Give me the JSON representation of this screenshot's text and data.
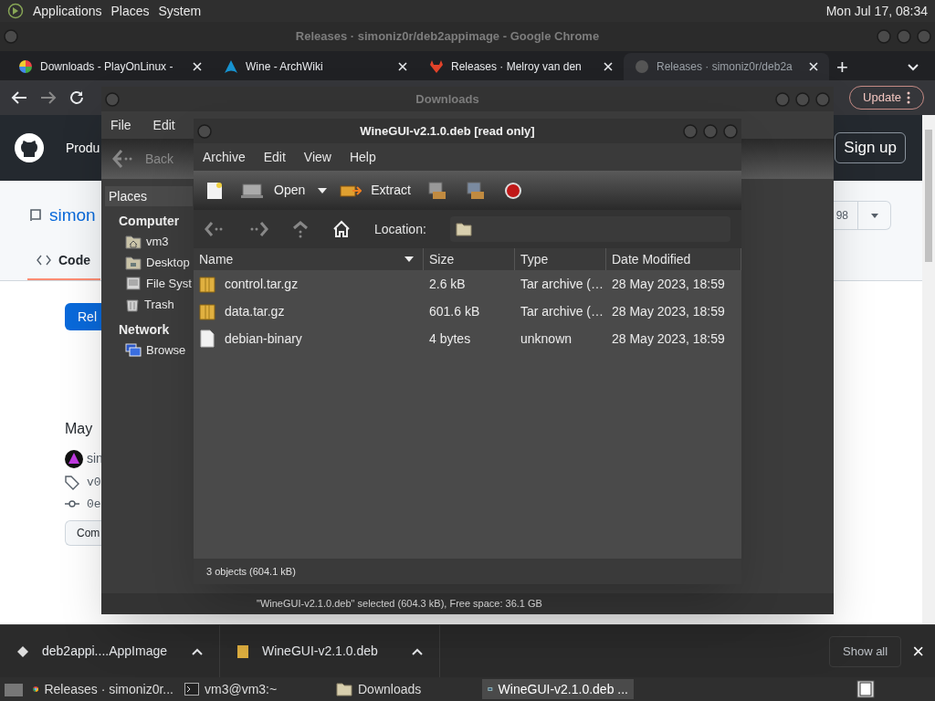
{
  "top_panel": {
    "menus": [
      "Applications",
      "Places",
      "System"
    ],
    "clock": "Mon Jul 17, 08:34"
  },
  "chrome": {
    "title": "Releases · simoniz0r/deb2appimage - Google Chrome",
    "tabs": [
      {
        "label": "Downloads - PlayOnLinux -",
        "selected": false
      },
      {
        "label": "Wine - ArchWiki",
        "selected": false
      },
      {
        "label": "Releases · Melroy van den",
        "selected": false
      },
      {
        "label": "Releases · simoniz0r/deb2a",
        "selected": true
      }
    ],
    "new_tab": "+",
    "update_button": "Update",
    "page": {
      "nav": "Produ",
      "sign_up": "Sign up",
      "repo": "simon",
      "counter": "98",
      "code_tab": "Code",
      "releases_button": "Rel",
      "date": "May",
      "author": "sin",
      "tag": "v0",
      "commit": "0e",
      "compare_button": "Com"
    },
    "downloads_bar": {
      "items": [
        {
          "kind": "appimage",
          "label": "deb2appi....AppImage"
        },
        {
          "kind": "archive",
          "label": "WineGUI-v2.1.0.deb"
        }
      ],
      "show_all": "Show all",
      "close": "×"
    }
  },
  "file_manager": {
    "title": "Downloads",
    "menus": [
      "File",
      "Edit"
    ],
    "back": "Back",
    "places_header": "Places",
    "sidebar": [
      {
        "label": "Computer",
        "children": [
          {
            "kind": "home",
            "label": "vm3"
          },
          {
            "kind": "desktop",
            "label": "Desktop"
          },
          {
            "kind": "drive",
            "label": "File Syst"
          },
          {
            "kind": "trash",
            "label": "Trash"
          }
        ]
      },
      {
        "label": "Network",
        "children": [
          {
            "kind": "network",
            "label": "Browse"
          }
        ]
      }
    ],
    "status": "\"WineGUI-v2.1.0.deb\" selected (604.3 kB), Free space: 36.1 GB"
  },
  "archive_manager": {
    "title": "WineGUI-v2.1.0.deb [read only]",
    "menus": [
      "Archive",
      "Edit",
      "View",
      "Help"
    ],
    "toolbar": {
      "open": "Open",
      "extract": "Extract"
    },
    "location_label": "Location:",
    "columns": [
      "Name",
      "Size",
      "Type",
      "Date Modified"
    ],
    "rows": [
      {
        "kind": "archive",
        "name": "control.tar.gz",
        "size": "2.6 kB",
        "type": "Tar archive (…",
        "date": "28 May 2023, 18:59",
        "selected": false
      },
      {
        "kind": "archive",
        "name": "data.tar.gz",
        "size": "601.6 kB",
        "type": "Tar archive (…",
        "date": "28 May 2023, 18:59",
        "selected": false
      },
      {
        "kind": "file",
        "name": "debian-binary",
        "size": "4 bytes",
        "type": "unknown",
        "date": "28 May 2023, 18:59",
        "selected": false
      }
    ],
    "status": "3 objects (604.1 kB)"
  },
  "taskbar": [
    {
      "kind": "chrome",
      "label": "Releases · simoniz0r...",
      "selected": false
    },
    {
      "kind": "terminal",
      "label": "vm3@vm3:~",
      "selected": false
    },
    {
      "kind": "folder",
      "label": "Downloads",
      "selected": false
    },
    {
      "kind": "archive",
      "label": "WineGUI-v2.1.0.deb ...",
      "selected": true
    }
  ]
}
